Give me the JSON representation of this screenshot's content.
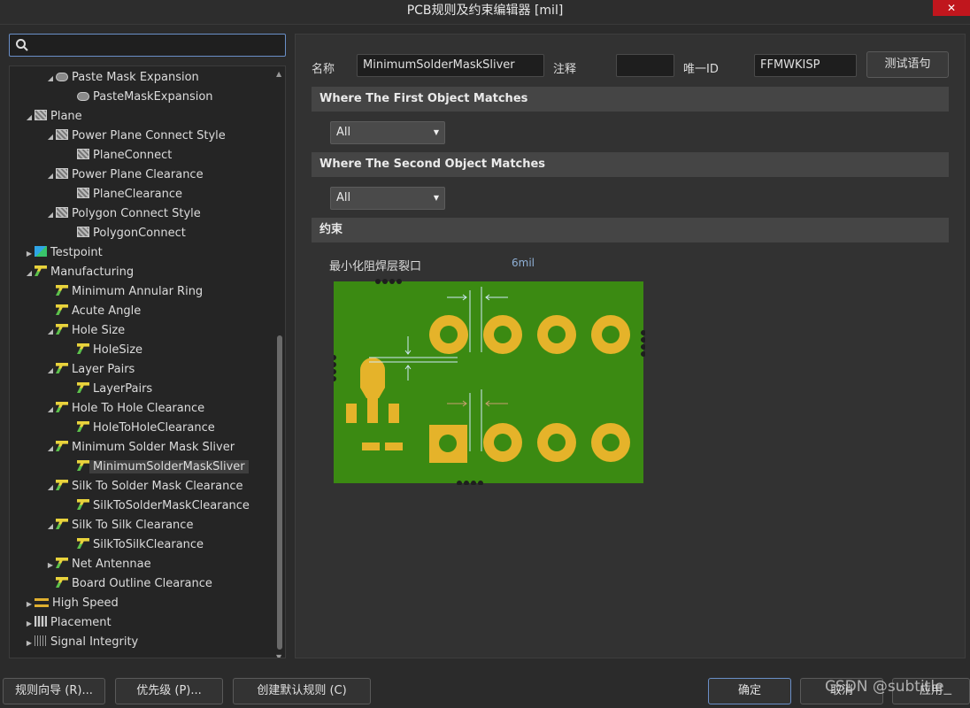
{
  "window": {
    "title": "PCB规则及约束编辑器 [mil]"
  },
  "search": {
    "placeholder": "",
    "value": ""
  },
  "tree": [
    {
      "label": "Paste Mask Expansion",
      "level": 2,
      "arrow": "down",
      "icon": "paste-icon"
    },
    {
      "label": "PasteMaskExpansion",
      "level": 3,
      "arrow": "",
      "icon": "paste-icon"
    },
    {
      "label": "Plane",
      "level": 1,
      "arrow": "down",
      "icon": "plane-icon"
    },
    {
      "label": "Power Plane Connect Style",
      "level": 2,
      "arrow": "down",
      "icon": "plane-icon"
    },
    {
      "label": "PlaneConnect",
      "level": 3,
      "arrow": "",
      "icon": "plane-icon"
    },
    {
      "label": "Power Plane Clearance",
      "level": 2,
      "arrow": "down",
      "icon": "plane-icon"
    },
    {
      "label": "PlaneClearance",
      "level": 3,
      "arrow": "",
      "icon": "plane-icon"
    },
    {
      "label": "Polygon Connect Style",
      "level": 2,
      "arrow": "down",
      "icon": "plane-icon"
    },
    {
      "label": "PolygonConnect",
      "level": 3,
      "arrow": "",
      "icon": "plane-icon"
    },
    {
      "label": "Testpoint",
      "level": 1,
      "arrow": "right",
      "icon": "testpoint-icon"
    },
    {
      "label": "Manufacturing",
      "level": 1,
      "arrow": "down",
      "icon": "manufacturing-icon"
    },
    {
      "label": "Minimum Annular Ring",
      "level": 2,
      "arrow": "",
      "icon": "manufacturing-icon"
    },
    {
      "label": "Acute Angle",
      "level": 2,
      "arrow": "",
      "icon": "manufacturing-icon"
    },
    {
      "label": "Hole Size",
      "level": 2,
      "arrow": "down",
      "icon": "manufacturing-icon"
    },
    {
      "label": "HoleSize",
      "level": 3,
      "arrow": "",
      "icon": "manufacturing-icon"
    },
    {
      "label": "Layer Pairs",
      "level": 2,
      "arrow": "down",
      "icon": "manufacturing-icon"
    },
    {
      "label": "LayerPairs",
      "level": 3,
      "arrow": "",
      "icon": "manufacturing-icon"
    },
    {
      "label": "Hole To Hole Clearance",
      "level": 2,
      "arrow": "down",
      "icon": "manufacturing-icon"
    },
    {
      "label": "HoleToHoleClearance",
      "level": 3,
      "arrow": "",
      "icon": "manufacturing-icon"
    },
    {
      "label": "Minimum Solder Mask Sliver",
      "level": 2,
      "arrow": "down",
      "icon": "manufacturing-icon"
    },
    {
      "label": "MinimumSolderMaskSliver",
      "level": 3,
      "arrow": "",
      "icon": "manufacturing-icon",
      "selected": true
    },
    {
      "label": "Silk To Solder Mask Clearance",
      "level": 2,
      "arrow": "down",
      "icon": "manufacturing-icon"
    },
    {
      "label": "SilkToSolderMaskClearance",
      "level": 3,
      "arrow": "",
      "icon": "manufacturing-icon"
    },
    {
      "label": "Silk To Silk Clearance",
      "level": 2,
      "arrow": "down",
      "icon": "manufacturing-icon"
    },
    {
      "label": "SilkToSilkClearance",
      "level": 3,
      "arrow": "",
      "icon": "manufacturing-icon"
    },
    {
      "label": "Net Antennae",
      "level": 2,
      "arrow": "right",
      "icon": "manufacturing-icon"
    },
    {
      "label": "Board Outline Clearance",
      "level": 2,
      "arrow": "",
      "icon": "manufacturing-icon"
    },
    {
      "label": "High Speed",
      "level": 1,
      "arrow": "right",
      "icon": "high-speed-icon"
    },
    {
      "label": "Placement",
      "level": 1,
      "arrow": "right",
      "icon": "placement-icon"
    },
    {
      "label": "Signal Integrity",
      "level": 1,
      "arrow": "right",
      "icon": "signal-integrity-icon"
    }
  ],
  "rule": {
    "name_label": "名称",
    "name_value": "MinimumSolderMaskSliver",
    "comment_label": "注释",
    "comment_value": "",
    "uid_label": "唯一ID",
    "uid_value": "FFMWKISP",
    "test_button": "测试语句"
  },
  "first_match": {
    "title": "Where The First Object Matches",
    "selected": "All"
  },
  "second_match": {
    "title": "Where The Second Object Matches",
    "selected": "All"
  },
  "constraints": {
    "title": "约束",
    "param_label": "最小化阻焊层裂口",
    "param_value": "6mil"
  },
  "footer": {
    "wizard": "规则向导 (R)...",
    "priority": "优先级 (P)...",
    "create_default": "创建默认规则 (C)",
    "ok": "确定",
    "cancel": "取消",
    "apply": "应用"
  },
  "watermark": "CSDN @subtitle_",
  "colors": {
    "board_green": "#3b8a12",
    "pad_yellow": "#e5b32a",
    "close_red": "#c0161d"
  }
}
